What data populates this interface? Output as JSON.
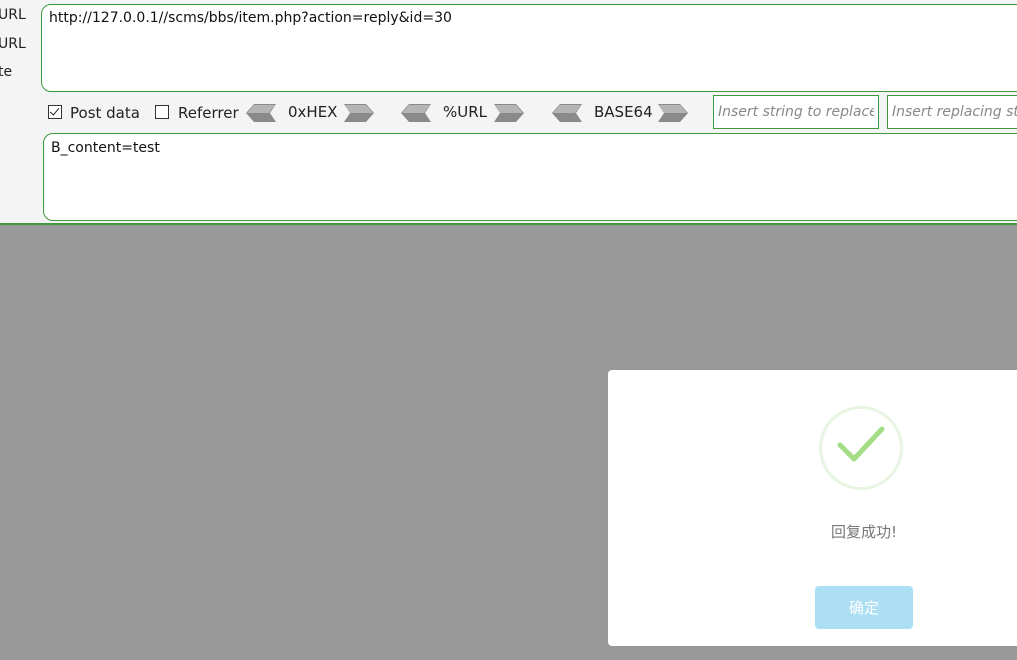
{
  "side_labels": [
    "URL",
    "URL",
    "te"
  ],
  "url_value": "http://127.0.0.1//scms/bbs/item.php?action=reply&id=30",
  "options": {
    "post_data": {
      "label": "Post data",
      "checked": true
    },
    "referrer": {
      "label": "Referrer",
      "checked": false
    }
  },
  "encoders": [
    "0xHEX",
    "%URL",
    "BASE64"
  ],
  "replace": {
    "find_placeholder": "Insert string to replace",
    "replace_placeholder": "Insert replacing string"
  },
  "post_body": "B_content=test",
  "dialog": {
    "icon": "success-check-icon",
    "message": "回复成功!",
    "ok_label": "确定"
  },
  "colors": {
    "accent_green": "#3c9a3c",
    "overlay": "#999999",
    "check_green": "#a5dc86",
    "button": "#acdff4"
  }
}
